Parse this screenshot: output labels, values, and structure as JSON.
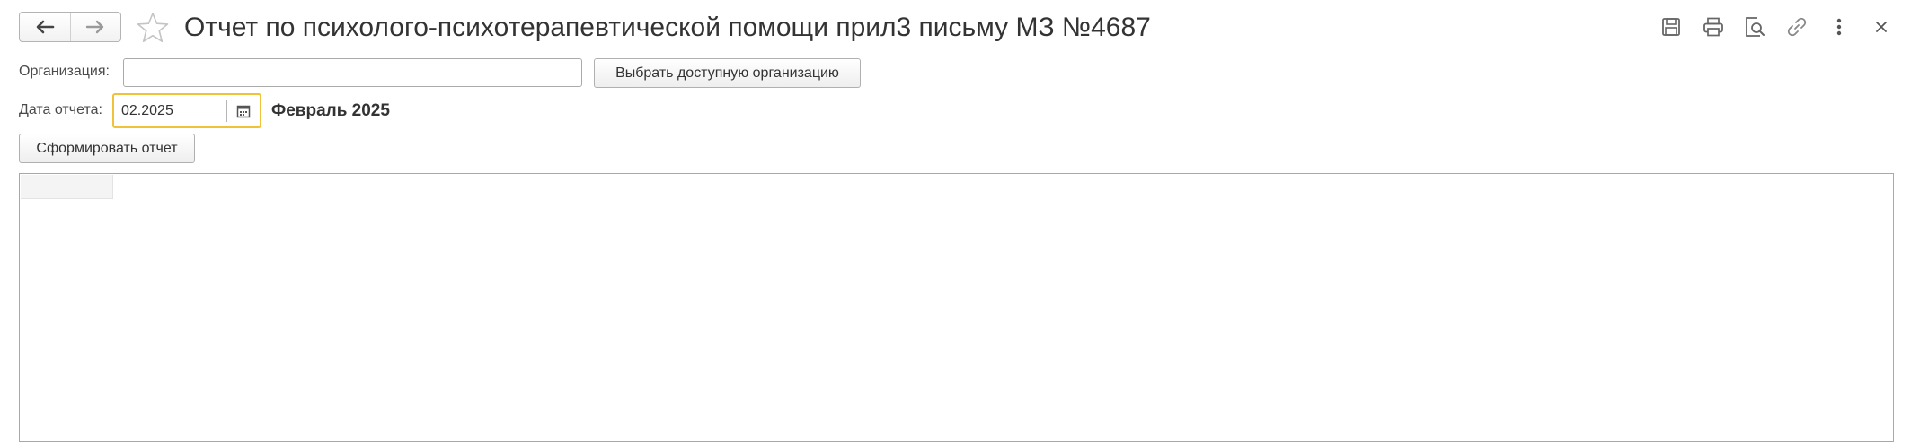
{
  "window": {
    "title": "Отчет по психолого-психотерапевтической помощи прил3 письму МЗ №4687"
  },
  "nav": {
    "back_icon": "arrow-left-icon",
    "forward_icon": "arrow-right-icon",
    "favorite_icon": "star-icon"
  },
  "toolbar": {
    "icons": [
      "save-icon",
      "print-icon",
      "preview-icon",
      "link-icon",
      "more-icon",
      "close-icon"
    ]
  },
  "form": {
    "organization_label": "Организация:",
    "organization_value": "",
    "choose_org_button": "Выбрать доступную организацию",
    "report_date_label": "Дата отчета:",
    "report_date_value": "02.2025",
    "report_period_text": "Февраль 2025",
    "generate_button": "Сформировать отчет"
  },
  "colors": {
    "focus_border": "#f0c23a",
    "text": "#333333",
    "border": "#aaaaaa"
  }
}
